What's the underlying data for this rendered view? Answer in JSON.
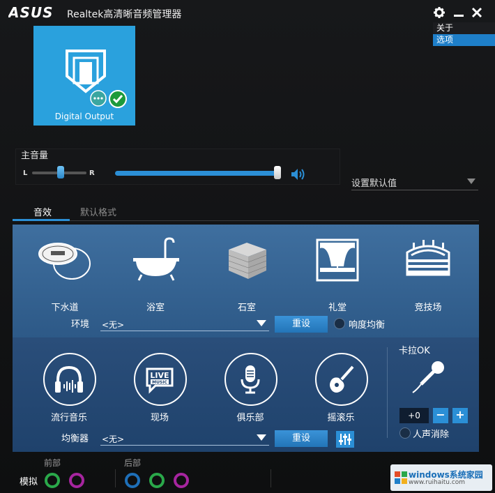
{
  "titlebar": {
    "brand": "ASUS",
    "title": "Realtek高清晰音频管理器",
    "icons": [
      "gear-icon",
      "minimize-icon",
      "close-icon"
    ]
  },
  "menu": {
    "items": [
      {
        "label": "关于",
        "selected": false
      },
      {
        "label": "选项",
        "selected": true
      }
    ]
  },
  "device": {
    "label": "Digital Output",
    "status_icons": [
      "chat-bubble-icon",
      "check-icon"
    ]
  },
  "volume": {
    "title": "主音量",
    "balance_left": "L",
    "balance_right": "R",
    "balance_level": 0.5,
    "master_level": 1.0
  },
  "default_dropdown": {
    "label": "设置默认值"
  },
  "tabs": [
    {
      "label": "音效",
      "active": true
    },
    {
      "label": "默认格式",
      "active": false
    }
  ],
  "environment": {
    "items": [
      {
        "label": "下水道",
        "icon": "sewer-icon"
      },
      {
        "label": "浴室",
        "icon": "bathtub-icon"
      },
      {
        "label": "石室",
        "icon": "stone-room-icon"
      },
      {
        "label": "礼堂",
        "icon": "auditorium-icon"
      },
      {
        "label": "竞技场",
        "icon": "arena-icon"
      }
    ],
    "row_label": "环境",
    "value": "<无>",
    "reset": "重设",
    "loudness_label": "响度均衡"
  },
  "equalizer": {
    "items": [
      {
        "label": "流行音乐",
        "icon": "headphones-icon"
      },
      {
        "label": "现场",
        "icon": "live-music-icon"
      },
      {
        "label": "俱乐部",
        "icon": "microphone-icon"
      },
      {
        "label": "摇滚乐",
        "icon": "guitar-icon"
      }
    ],
    "row_label": "均衡器",
    "value": "<无>",
    "reset": "重设"
  },
  "karaoke": {
    "title": "卡拉OK",
    "value": "+0",
    "minus": "−",
    "plus": "+",
    "voice_cancel_label": "人声消除"
  },
  "jacks": {
    "front_label": "前部",
    "back_label": "后部",
    "analog_label": "模拟",
    "colors": {
      "green": "#2aa84a",
      "purple": "#a6259f",
      "blue": "#1e6fb8"
    }
  },
  "watermark": {
    "text": "windows系统家园",
    "url": "www.ruihaitu.com"
  }
}
